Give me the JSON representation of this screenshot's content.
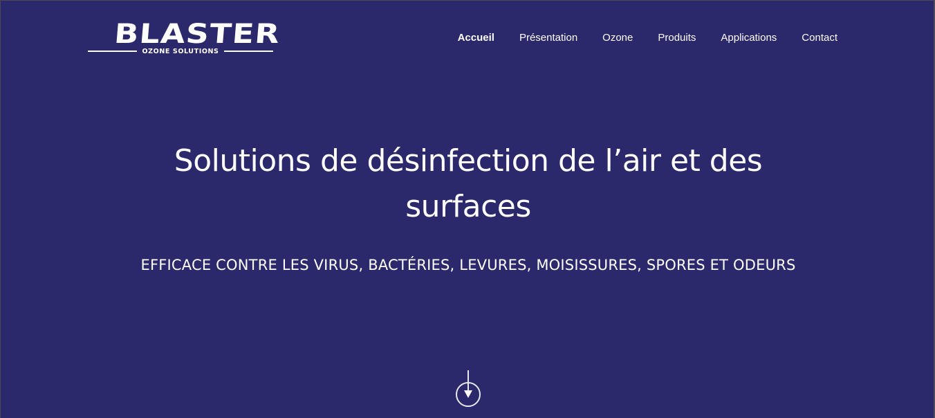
{
  "brand": {
    "name": "BLASTER",
    "tagline": "OZONE SOLUTIONS"
  },
  "nav": {
    "items": [
      {
        "label": "Accueil",
        "active": true
      },
      {
        "label": "Présentation",
        "active": false
      },
      {
        "label": "Ozone",
        "active": false
      },
      {
        "label": "Produits",
        "active": false
      },
      {
        "label": "Applications",
        "active": false
      },
      {
        "label": "Contact",
        "active": false
      }
    ]
  },
  "hero": {
    "title": "Solutions de désinfection de l’air et des surfaces",
    "subtitle": "EFFICACE CONTRE LES VIRUS, BACTÉRIES, LEVURES, MOISISSURES, SPORES ET ODEURS",
    "scroll_icon": "arrow-down-circle-icon"
  },
  "colors": {
    "background": "#2c286c",
    "text": "#ffffff",
    "frame": "#4b4a55"
  }
}
